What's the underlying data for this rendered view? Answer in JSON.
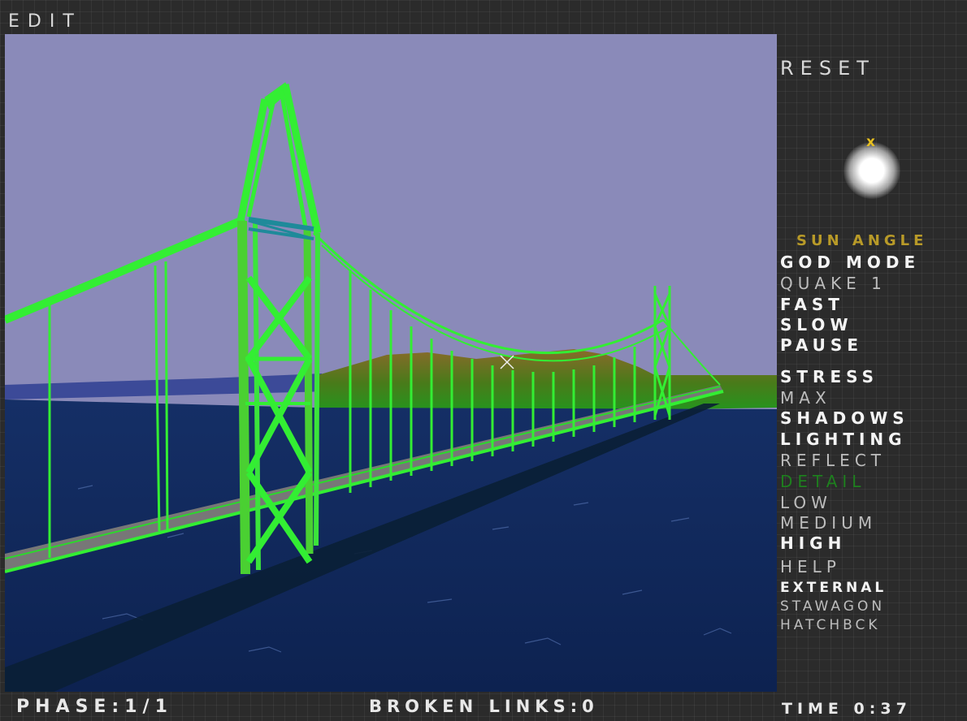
{
  "top_bar": {
    "edit_label": "EDIT"
  },
  "sidebar": {
    "reset_label": "RESET",
    "sun_marker": "x",
    "sun_angle_label": "SUN ANGLE",
    "god_mode": "GOD MODE",
    "quake": "QUAKE 1",
    "fast": "FAST",
    "slow": "SLOW",
    "pause": "PAUSE",
    "stress": "STRESS",
    "max": "MAX",
    "shadows": "SHADOWS",
    "lighting": "LIGHTING",
    "reflect": "REFLECT",
    "detail": "DETAIL",
    "low": "LOW",
    "medium": "MEDIUM",
    "high": "HIGH",
    "help": "HELP",
    "external": "EXTERNAL",
    "stawagon": "STAWAGON",
    "hatchbck": "HATCHBCK"
  },
  "status_bar": {
    "phase": "PHASE:1/1",
    "broken_links": "BROKEN LINKS:0",
    "time": "TIME 0:37"
  },
  "colors": {
    "sky": "#8a8ab9",
    "water": "#122a5e",
    "bridge": "#33ee33",
    "sun_label": "#b89a28",
    "detail_label": "#1e7f1e"
  }
}
